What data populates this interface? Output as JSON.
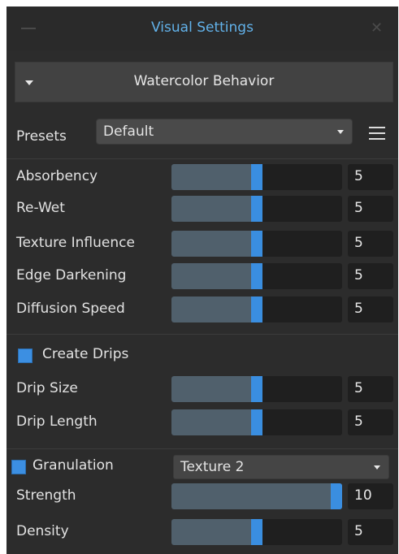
{
  "window": {
    "title": "Visual Settings"
  },
  "section": {
    "title": "Watercolor Behavior"
  },
  "presets": {
    "label": "Presets",
    "value": "Default"
  },
  "behavior": [
    {
      "label": "Absorbency",
      "value": "5",
      "level": 0.5
    },
    {
      "label": "Re-Wet",
      "value": "5",
      "level": 0.5
    },
    {
      "label": "Texture Influence",
      "value": "5",
      "level": 0.5
    },
    {
      "label": "Edge Darkening",
      "value": "5",
      "level": 0.5
    },
    {
      "label": "Diffusion Speed",
      "value": "5",
      "level": 0.5
    }
  ],
  "drips": {
    "label": "Create Drips",
    "checked": true,
    "sliders": [
      {
        "label": "Drip Size",
        "value": "5",
        "level": 0.5
      },
      {
        "label": "Drip Length",
        "value": "5",
        "level": 0.5
      }
    ]
  },
  "granulation": {
    "label": "Granulation",
    "checked": true,
    "texture": "Texture 2",
    "sliders": [
      {
        "label": "Strength",
        "value": "10",
        "level": 1.0
      },
      {
        "label": "Density",
        "value": "5",
        "level": 0.5
      }
    ]
  },
  "colors": {
    "accent": "#3a8ee0",
    "title": "#62b2ea",
    "panel": "#2c2c2c"
  }
}
